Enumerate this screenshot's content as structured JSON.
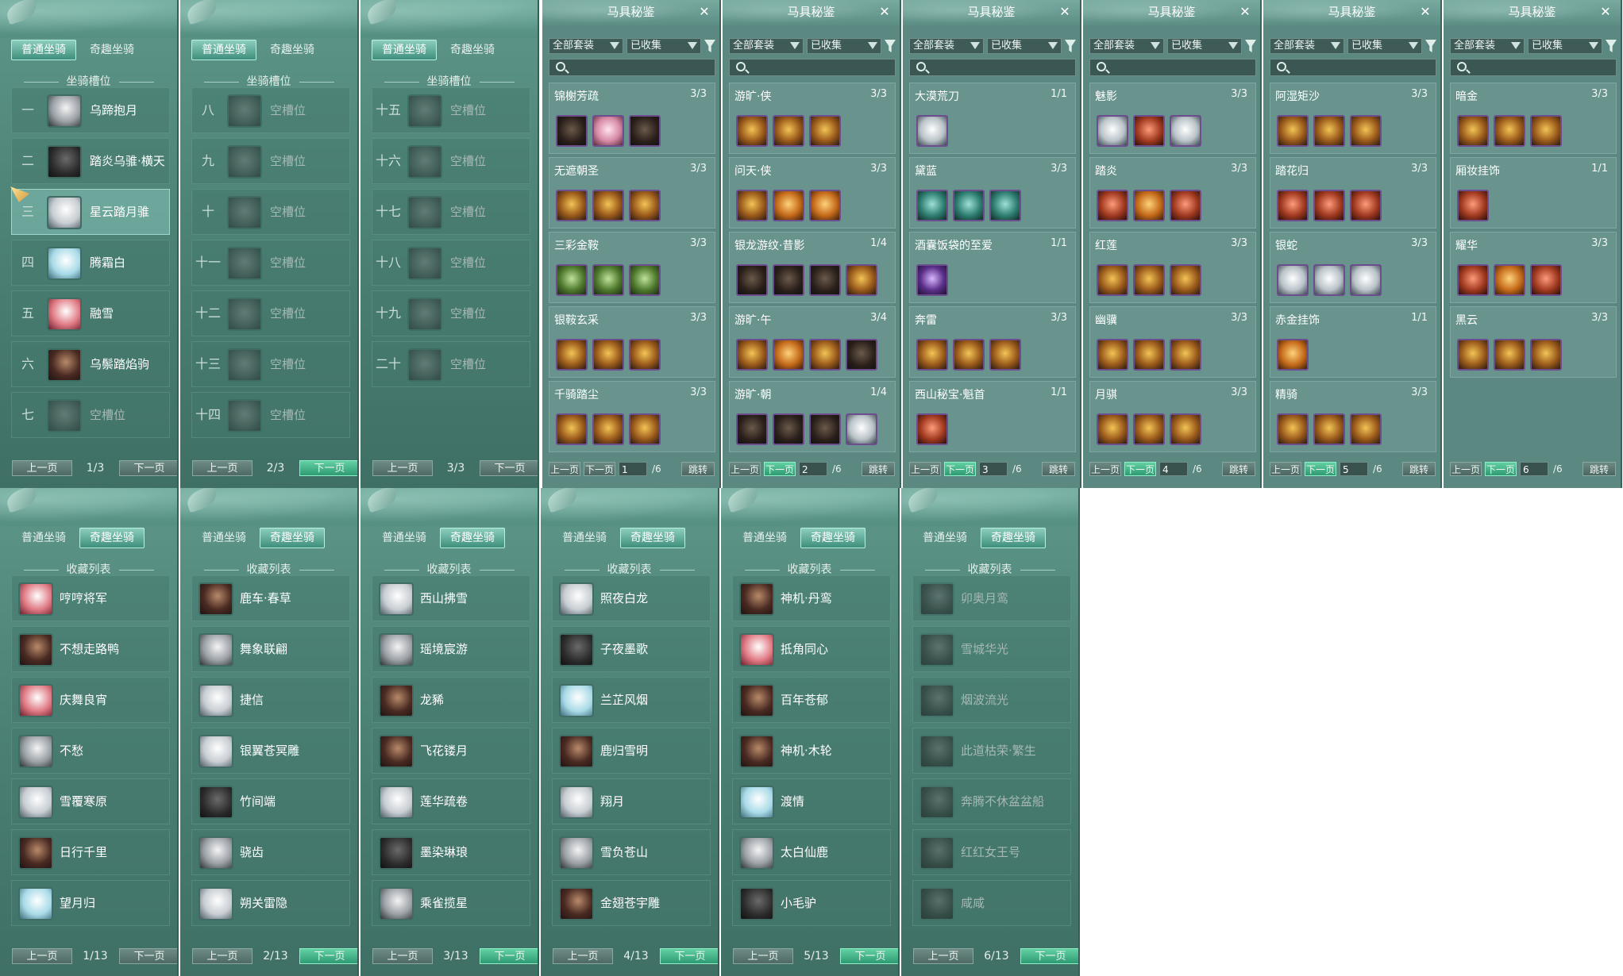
{
  "slot_panels": [
    {
      "tabs": [
        "普通坐骑",
        "奇趣坐骑"
      ],
      "active_tab": 0,
      "section": "坐骑槽位",
      "rows": [
        {
          "num": "一",
          "label": "乌蹄抱月",
          "empty": false,
          "style": "m1"
        },
        {
          "num": "二",
          "label": "踏炎乌骓·横天",
          "empty": false,
          "style": "m2"
        },
        {
          "num": "三",
          "label": "星云踏月骓",
          "empty": false,
          "style": "m3",
          "selected": true
        },
        {
          "num": "四",
          "label": "腾霜白",
          "empty": false,
          "style": "m4"
        },
        {
          "num": "五",
          "label": "融雪",
          "empty": false,
          "style": "m5"
        },
        {
          "num": "六",
          "label": "乌鬃踏焰驹",
          "empty": false,
          "style": "m6"
        },
        {
          "num": "七",
          "label": "空槽位",
          "empty": true
        }
      ],
      "pager": {
        "prev": "上一页",
        "next": "下一页",
        "page": "1/3",
        "next_active": false
      }
    },
    {
      "tabs": [
        "普通坐骑",
        "奇趣坐骑"
      ],
      "active_tab": 0,
      "section": "坐骑槽位",
      "rows": [
        {
          "num": "八",
          "label": "空槽位",
          "empty": true
        },
        {
          "num": "九",
          "label": "空槽位",
          "empty": true
        },
        {
          "num": "十",
          "label": "空槽位",
          "empty": true
        },
        {
          "num": "十一",
          "label": "空槽位",
          "empty": true
        },
        {
          "num": "十二",
          "label": "空槽位",
          "empty": true
        },
        {
          "num": "十三",
          "label": "空槽位",
          "empty": true
        },
        {
          "num": "十四",
          "label": "空槽位",
          "empty": true
        }
      ],
      "pager": {
        "prev": "上一页",
        "next": "下一页",
        "page": "2/3",
        "next_active": true
      }
    },
    {
      "tabs": [
        "普通坐骑",
        "奇趣坐骑"
      ],
      "active_tab": 0,
      "section": "坐骑槽位",
      "rows": [
        {
          "num": "十五",
          "label": "空槽位",
          "empty": true
        },
        {
          "num": "十六",
          "label": "空槽位",
          "empty": true
        },
        {
          "num": "十七",
          "label": "空槽位",
          "empty": true
        },
        {
          "num": "十八",
          "label": "空槽位",
          "empty": true
        },
        {
          "num": "十九",
          "label": "空槽位",
          "empty": true
        },
        {
          "num": "二十",
          "label": "空槽位",
          "empty": true
        }
      ],
      "pager": {
        "prev": "上一页",
        "next": "下一页",
        "page": "3/3",
        "next_active": false
      }
    }
  ],
  "harness_panels": [
    {
      "title": "马具秘鉴",
      "filter1": "全部套装",
      "filter2": "已收集",
      "groups": [
        {
          "name": "锦榭芳疏",
          "count": "3/3",
          "icons": [
            "dark",
            "pink",
            "dark"
          ]
        },
        {
          "name": "无遮朝圣",
          "count": "3/3",
          "icons": [
            "gold",
            "gold",
            "gold"
          ]
        },
        {
          "name": "三彩金鞍",
          "count": "3/3",
          "icons": [
            "green",
            "green",
            "green"
          ]
        },
        {
          "name": "银鞍玄采",
          "count": "3/3",
          "icons": [
            "gold",
            "gold",
            "gold"
          ]
        },
        {
          "name": "千骑踏尘",
          "count": "3/3",
          "icons": [
            "gold",
            "gold",
            "gold"
          ]
        }
      ],
      "pager": {
        "prev": "上一页",
        "next": "下一页",
        "page": "1",
        "total": "/6",
        "jump": "跳转"
      }
    },
    {
      "title": "马具秘鉴",
      "filter1": "全部套装",
      "filter2": "已收集",
      "groups": [
        {
          "name": "游旷·侠",
          "count": "3/3",
          "icons": [
            "gold",
            "gold",
            "gold"
          ]
        },
        {
          "name": "问天·侠",
          "count": "3/3",
          "icons": [
            "gold",
            "orange",
            "orange"
          ]
        },
        {
          "name": "银龙游纹·昔影",
          "count": "1/4",
          "icons": [
            "dark",
            "dark",
            "dark",
            "gold"
          ]
        },
        {
          "name": "游旷·午",
          "count": "3/4",
          "icons": [
            "gold",
            "orange",
            "gold",
            "dark"
          ]
        },
        {
          "name": "游旷·朝",
          "count": "1/4",
          "icons": [
            "dark",
            "dark",
            "dark",
            "white"
          ]
        }
      ],
      "pager": {
        "prev": "上一页",
        "next": "下一页",
        "page": "2",
        "total": "/6",
        "jump": "跳转"
      }
    },
    {
      "title": "马具秘鉴",
      "filter1": "全部套装",
      "filter2": "已收集",
      "groups": [
        {
          "name": "大漠荒刀",
          "count": "1/1",
          "icons": [
            "white"
          ]
        },
        {
          "name": "黛蓝",
          "count": "3/3",
          "icons": [
            "teal",
            "teal",
            "teal"
          ]
        },
        {
          "name": "酒囊饭袋的至爱",
          "count": "1/1",
          "icons": [
            "purple"
          ]
        },
        {
          "name": "奔雷",
          "count": "3/3",
          "icons": [
            "gold",
            "gold",
            "gold"
          ]
        },
        {
          "name": "西山秘宝·魁首",
          "count": "1/1",
          "icons": [
            "red"
          ]
        }
      ],
      "pager": {
        "prev": "上一页",
        "next": "下一页",
        "page": "3",
        "total": "/6",
        "jump": "跳转"
      }
    },
    {
      "title": "马具秘鉴",
      "filter1": "全部套装",
      "filter2": "已收集",
      "groups": [
        {
          "name": "魅影",
          "count": "3/3",
          "icons": [
            "white",
            "red",
            "white"
          ]
        },
        {
          "name": "踏炎",
          "count": "3/3",
          "icons": [
            "red",
            "orange",
            "red"
          ]
        },
        {
          "name": "红莲",
          "count": "3/3",
          "icons": [
            "gold",
            "gold",
            "gold"
          ]
        },
        {
          "name": "幽骥",
          "count": "3/3",
          "icons": [
            "gold",
            "gold",
            "gold"
          ]
        },
        {
          "name": "月骐",
          "count": "3/3",
          "icons": [
            "gold",
            "gold",
            "gold"
          ]
        }
      ],
      "pager": {
        "prev": "上一页",
        "next": "下一页",
        "page": "4",
        "total": "/6",
        "jump": "跳转"
      }
    },
    {
      "title": "马具秘鉴",
      "filter1": "全部套装",
      "filter2": "已收集",
      "groups": [
        {
          "name": "阿湿矩沙",
          "count": "3/3",
          "icons": [
            "gold",
            "gold",
            "gold"
          ]
        },
        {
          "name": "踏花归",
          "count": "3/3",
          "icons": [
            "red",
            "red",
            "red"
          ]
        },
        {
          "name": "银蛇",
          "count": "3/3",
          "icons": [
            "white",
            "white",
            "white"
          ]
        },
        {
          "name": "赤金挂饰",
          "count": "1/1",
          "icons": [
            "orange"
          ]
        },
        {
          "name": "精骑",
          "count": "3/3",
          "icons": [
            "gold",
            "gold",
            "gold"
          ]
        }
      ],
      "pager": {
        "prev": "上一页",
        "next": "下一页",
        "page": "5",
        "total": "/6",
        "jump": "跳转"
      }
    },
    {
      "title": "马具秘鉴",
      "filter1": "全部套装",
      "filter2": "已收集",
      "groups": [
        {
          "name": "暗金",
          "count": "3/3",
          "icons": [
            "gold",
            "gold",
            "gold"
          ]
        },
        {
          "name": "厢妆挂饰",
          "count": "1/1",
          "icons": [
            "red"
          ]
        },
        {
          "name": "耀华",
          "count": "3/3",
          "icons": [
            "red",
            "orange",
            "red"
          ]
        },
        {
          "name": "黑云",
          "count": "3/3",
          "icons": [
            "gold",
            "gold",
            "gold"
          ]
        }
      ],
      "pager": {
        "prev": "上一页",
        "next": "下一页",
        "page": "6",
        "total": "/6",
        "jump": "跳转"
      }
    }
  ],
  "collection_panels": [
    {
      "tabs": [
        "普通坐骑",
        "奇趣坐骑"
      ],
      "active_tab": 1,
      "section": "收藏列表",
      "rows": [
        {
          "label": "哼哼将军",
          "style": "m5"
        },
        {
          "label": "不想走路鸭",
          "style": "m6"
        },
        {
          "label": "庆舞良宵",
          "style": "m5"
        },
        {
          "label": "不愁",
          "style": "m1"
        },
        {
          "label": "雪覆寒原",
          "style": "m3"
        },
        {
          "label": "日行千里",
          "style": "m6"
        },
        {
          "label": "望月归",
          "style": "m4"
        }
      ],
      "pager": {
        "prev": "上一页",
        "next": "下一页",
        "page": "1/13",
        "next_active": false
      }
    },
    {
      "tabs": [
        "普通坐骑",
        "奇趣坐骑"
      ],
      "active_tab": 1,
      "section": "收藏列表",
      "rows": [
        {
          "label": "鹿车·春草",
          "style": "m6"
        },
        {
          "label": "舞象联翩",
          "style": "m1"
        },
        {
          "label": "捷信",
          "style": "m3"
        },
        {
          "label": "银翼苍冥雕",
          "style": "m3"
        },
        {
          "label": "竹间端",
          "style": "m2"
        },
        {
          "label": "骁齿",
          "style": "m1"
        },
        {
          "label": "朔关雷隐",
          "style": "m3"
        }
      ],
      "pager": {
        "prev": "上一页",
        "next": "下一页",
        "page": "2/13",
        "next_active": true
      }
    },
    {
      "tabs": [
        "普通坐骑",
        "奇趣坐骑"
      ],
      "active_tab": 1,
      "section": "收藏列表",
      "rows": [
        {
          "label": "西山拂雪",
          "style": "m3"
        },
        {
          "label": "瑶境宸游",
          "style": "m1"
        },
        {
          "label": "龙豨",
          "style": "m6"
        },
        {
          "label": "飞花镂月",
          "style": "m6"
        },
        {
          "label": "莲华疏卷",
          "style": "m3"
        },
        {
          "label": "墨染琳琅",
          "style": "m2"
        },
        {
          "label": "乘雀揽星",
          "style": "m1"
        }
      ],
      "pager": {
        "prev": "上一页",
        "next": "下一页",
        "page": "3/13",
        "next_active": true
      }
    },
    {
      "tabs": [
        "普通坐骑",
        "奇趣坐骑"
      ],
      "active_tab": 1,
      "section": "收藏列表",
      "rows": [
        {
          "label": "照夜白龙",
          "style": "m3"
        },
        {
          "label": "子夜墨歌",
          "style": "m2"
        },
        {
          "label": "兰芷风烟",
          "style": "m4"
        },
        {
          "label": "鹿归雪明",
          "style": "m6"
        },
        {
          "label": "翔月",
          "style": "m3"
        },
        {
          "label": "雪负苍山",
          "style": "m1"
        },
        {
          "label": "金翅苍宇雕",
          "style": "m6"
        }
      ],
      "pager": {
        "prev": "上一页",
        "next": "下一页",
        "page": "4/13",
        "next_active": true
      }
    },
    {
      "tabs": [
        "普通坐骑",
        "奇趣坐骑"
      ],
      "active_tab": 1,
      "section": "收藏列表",
      "rows": [
        {
          "label": "神机·丹鸾",
          "style": "m6"
        },
        {
          "label": "抵角同心",
          "style": "m5"
        },
        {
          "label": "百年苍郁",
          "style": "m6"
        },
        {
          "label": "神机·木轮",
          "style": "m6"
        },
        {
          "label": "渡情",
          "style": "m4"
        },
        {
          "label": "太白仙鹿",
          "style": "m1"
        },
        {
          "label": "小毛驴",
          "style": "m2"
        }
      ],
      "pager": {
        "prev": "上一页",
        "next": "下一页",
        "page": "5/13",
        "next_active": true
      }
    },
    {
      "tabs": [
        "普通坐骑",
        "奇趣坐骑"
      ],
      "active_tab": 1,
      "section": "收藏列表",
      "rows": [
        {
          "label": "卯奥月鸾",
          "style": "m2",
          "dim": true
        },
        {
          "label": "雪城华光",
          "style": "m2",
          "dim": true
        },
        {
          "label": "烟波流光",
          "style": "m2",
          "dim": true
        },
        {
          "label": "此道枯荣·繁生",
          "style": "m2",
          "dim": true
        },
        {
          "label": "奔腾不休盆盆船",
          "style": "m2",
          "dim": true
        },
        {
          "label": "红红女王号",
          "style": "m2",
          "dim": true
        },
        {
          "label": "咸咸",
          "style": "m2",
          "dim": true
        }
      ],
      "pager": {
        "prev": "上一页",
        "next": "下一页",
        "page": "6/13",
        "next_active": true
      }
    }
  ]
}
